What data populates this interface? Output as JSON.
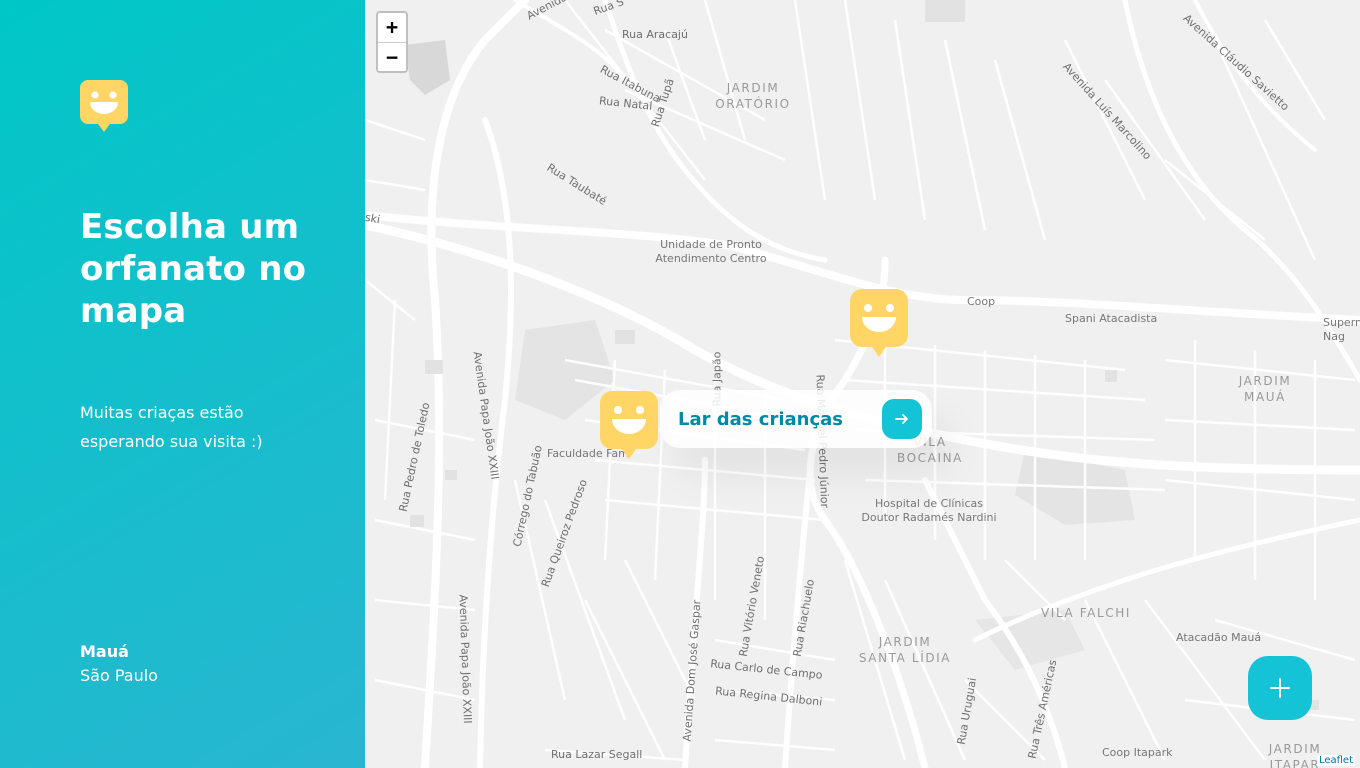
{
  "brand": {
    "logo_icon": "smiley-pin-icon",
    "color": "#FFD666"
  },
  "sidebar": {
    "headline": "Escolha um orfanato no mapa",
    "subheadline": "Muitas criaças estão esperando sua visita :)",
    "city": "Mauá",
    "state": "São Paulo",
    "gradient": [
      "#00C7C7",
      "#29B6D1"
    ]
  },
  "map": {
    "zoom_in_label": "+",
    "zoom_out_label": "−",
    "attribution": "Leaflet",
    "labels": {
      "jardim_oratorio": "JARDIM ORATÓRIO",
      "jardim_maua": "JARDIM MAUÁ",
      "vila_bocaina": "VILA BOCAINA",
      "vila_falchi": "VILA FALCHI",
      "jardim_santa_lidia": "JARDIM SANTA LÍDIA",
      "jardim_itapark": "JARDIM ITAPAR",
      "upa": "Unidade de Pronto Atendimento Centro",
      "hospital": "Hospital de Clínicas Doutor Radamés Nardini",
      "coop": "Coop",
      "spani": "Spani Atacadista",
      "supern": "Supern Nag",
      "atacadao": "Atacadão Mauá",
      "coop_itapark": "Coop Itapark",
      "faculdade": "Faculdade Fam",
      "rua_aracaju": "Rua Aracajú",
      "rua_itabuna": "Rua Itabuna",
      "rua_natal": "Rua Natal",
      "rua_tupa": "Rua Tupã",
      "rua_taubate": "Rua Taubaté",
      "av_claudio": "Avenida Cláudio Savietto",
      "av_luis": "Avenida Luís Marcolino",
      "av_papa1": "Avenida Papa João XXIII",
      "av_papa2": "Avenida Papa João XXIII",
      "rua_pedro_toledo": "Rua Pedro de Toledo",
      "corrego": "Córrego do Tabuão",
      "rua_queiroz": "Rua Queiroz Pedroso",
      "av_dom_jose": "Avenida Dom José Gaspar",
      "rua_vitorio": "Rua Vitório Veneto",
      "rua_riachuelo": "Rua Riachuelo",
      "rua_carlo": "Rua Carlo de Campo",
      "rua_regina": "Rua Regina Dalboni",
      "rua_lazar": "Rua Lazar Segall",
      "rua_uruguai": "Rua Uruguai",
      "rua_tres": "Rua Três Américas",
      "rua_japao": "Rua Japão",
      "rua_pedro_junior": "Rua Manoel Pedro Júnior",
      "avenida_top": "Avenida",
      "rua_top": "Rua S",
      "ski": "ski"
    }
  },
  "markers": [
    {
      "name": "marker-1",
      "icon": "smiley-pin-icon"
    },
    {
      "name": "marker-2",
      "icon": "smiley-pin-icon"
    }
  ],
  "popup": {
    "title": "Lar das crianças",
    "button_icon": "arrow-right-icon"
  },
  "fab": {
    "icon": "plus-icon",
    "color": "#15C3D6"
  }
}
